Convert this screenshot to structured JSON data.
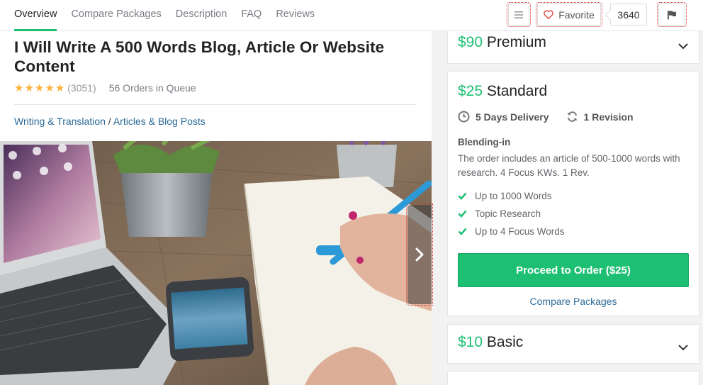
{
  "nav": {
    "tabs": [
      {
        "label": "Overview",
        "active": true
      },
      {
        "label": "Compare Packages",
        "active": false
      },
      {
        "label": "Description",
        "active": false
      },
      {
        "label": "FAQ",
        "active": false
      },
      {
        "label": "Reviews",
        "active": false
      }
    ],
    "menu_icon": "hamburger-icon",
    "favorite_label": "Favorite",
    "favorite_count": "3640",
    "flag_icon": "flag-icon"
  },
  "gig": {
    "title": "I Will Write A 500 Words Blog, Article Or Website Content",
    "stars": "★★★★★",
    "rating_count": "(3051)",
    "queue": "56 Orders in Queue",
    "category": "Writing & Translation",
    "separator": " / ",
    "subcategory": "Articles & Blog Posts"
  },
  "packages": {
    "premium": {
      "price": "$90",
      "name": "Premium"
    },
    "standard": {
      "price": "$25",
      "name": "Standard",
      "delivery": "5 Days Delivery",
      "revisions": "1 Revision",
      "desc_title": "Blending-in",
      "description": "The order includes an article of 500-1000 words with research. 4 Focus KWs. 1 Rev.",
      "features": [
        "Up to 1000 Words",
        "Topic Research",
        "Up to 4 Focus Words"
      ],
      "order_button": "Proceed to Order ($25)",
      "compare_link": "Compare Packages"
    },
    "basic": {
      "price": "$10",
      "name": "Basic"
    }
  },
  "colors": {
    "accent": "#1dbf73",
    "link": "#2c6a96",
    "star": "#ffb33e"
  }
}
